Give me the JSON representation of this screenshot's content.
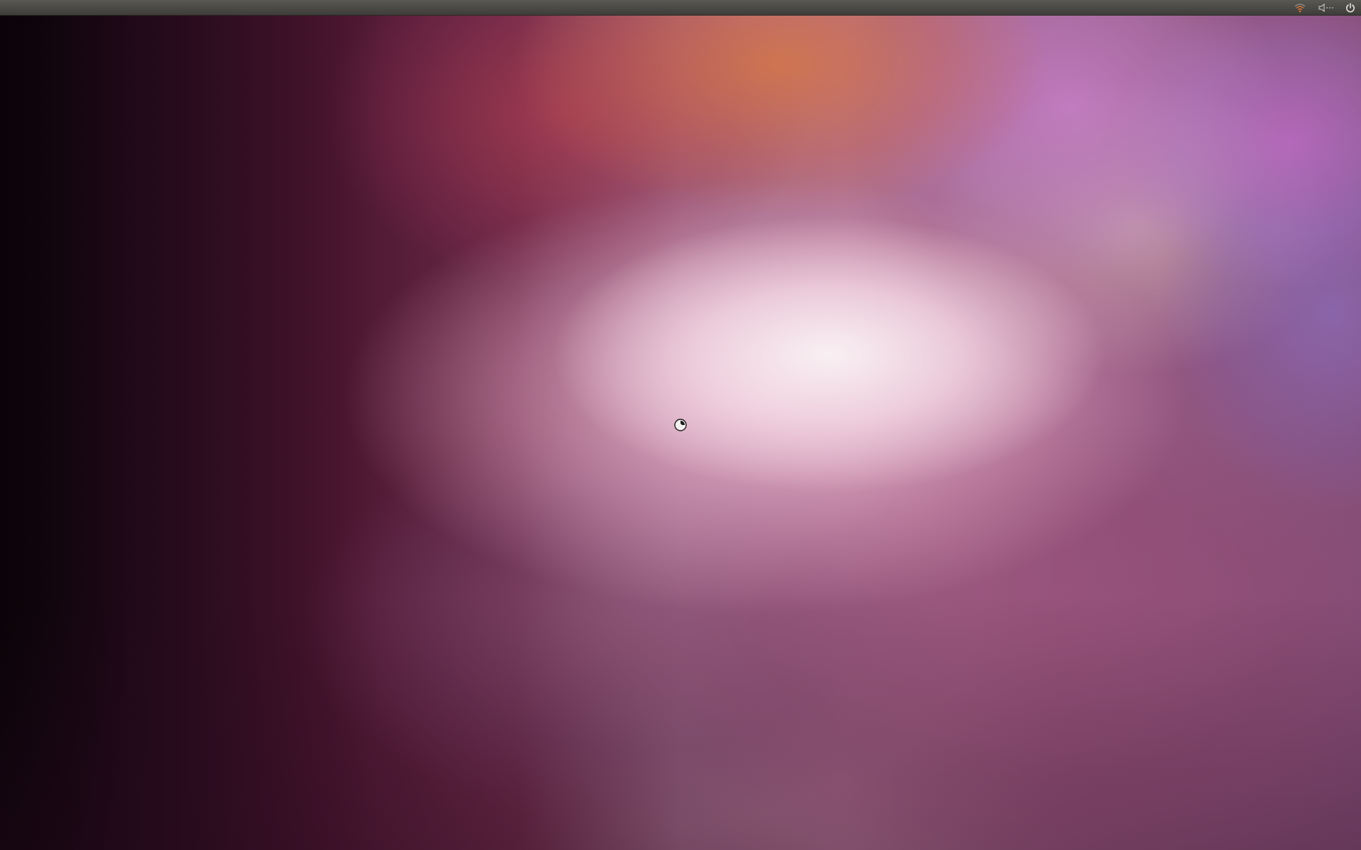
{
  "desktop": {
    "colors": {
      "panel": "#4a4945",
      "wallpaper_accent_pink": "#f3dbe6",
      "wallpaper_accent_orange": "#d6764a",
      "wallpaper_dark_purple": "#2c0d21",
      "indicator_icon": "#d8d6cf",
      "network_icon_active": "#e07a3a"
    }
  },
  "top_panel": {
    "indicators": [
      {
        "name": "wifi-icon"
      },
      {
        "name": "volume-icon"
      },
      {
        "name": "power-icon"
      }
    ]
  },
  "cursor": {
    "name": "busy-cursor-icon"
  }
}
